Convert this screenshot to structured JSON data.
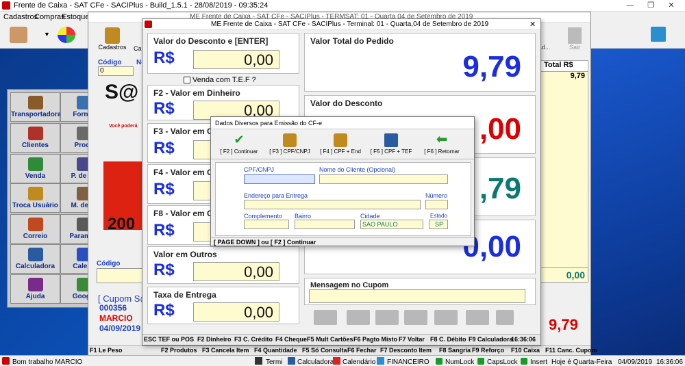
{
  "main_window": {
    "title": "Frente de Caixa - SAT CFe - SACIPlus - Build_1.5.1 - 28/08/2019 - 09:35:24",
    "menu": [
      "Cadastros",
      "Compras",
      "Estoque"
    ],
    "minimize": "—",
    "restore": "❐",
    "close": "✕"
  },
  "tiles": [
    {
      "label": "Transportadora",
      "color": "#8a5a2a"
    },
    {
      "label": "Fornec",
      "color": "#3a6fb0"
    },
    {
      "label": "Clientes",
      "color": "#b0302a"
    },
    {
      "label": "Produ",
      "color": "#6a6a6a"
    },
    {
      "label": "Venda",
      "color": "#2f8a3a"
    },
    {
      "label": "P. de Co",
      "color": "#4a4a8a"
    },
    {
      "label": "Troca Usuário",
      "color": "#c08a20"
    },
    {
      "label": "M. de Ar",
      "color": "#806040"
    },
    {
      "label": "Correio",
      "color": "#c04a20"
    },
    {
      "label": "Parametr",
      "color": "#5a5a5a"
    },
    {
      "label": "Calculadora",
      "color": "#2a5aa0"
    },
    {
      "label": "Calend",
      "color": "#2a4fc0"
    },
    {
      "label": "Ajuda",
      "color": "#7a2a8a"
    },
    {
      "label": "Google",
      "color": "#3a8a3a"
    }
  ],
  "pos_window": {
    "title": "ME Frente de Caixa - SAT CFe - SACIPlus - TERMSAT: 01 - Quarta 04 de Setembro de 2019",
    "codigo_label": "Código",
    "codigo_value": "0",
    "no_label": "No",
    "logo_text": "S@",
    "promo_text": "Você poderá",
    "year_text": "200",
    "codigo2_label": "Código",
    "cupom_label": "[ Cupom S@",
    "cupom_number": "000356",
    "operator": "MARCIO",
    "date": "04/09/2019",
    "total_header": "Total R$",
    "total_value": "9,79",
    "desconto_total": "0,00",
    "grand_total": "9,79",
    "toolbar_left_label": "Cadastros",
    "toolbar_left_label2": "Ca",
    "toolbar_right_label": "Ad...",
    "toolbar_sair": "Sair",
    "fkeys": [
      "F1 Le Peso",
      "F2 Produtos",
      "F3 Cancela Item",
      "F4 Quantidade",
      "F5 Só Consulta",
      "F6 Fechar",
      "F7 Desconto Item",
      "F8 Sangria",
      "F9 Reforço",
      "F10 Caixa",
      "F11 Canc. Cupom"
    ]
  },
  "payment_window": {
    "title": "ME Frente de Caixa - SAT CFe - SACIPlus - Terminal: 01 - Quarta,04 de Setembro de 2019",
    "desconto_label": "Valor do Desconto e [ENTER]",
    "desconto_value": "0,00",
    "tef_label": "Venda com T.E.F ?",
    "dinheiro_label": "F2 - Valor em Dinheiro",
    "dinheiro_value": "0,00",
    "f3_label": "F3 - Valor em C",
    "f4_label": "F4 - Valor em C",
    "f8_label": "F8 - Valor em C",
    "outros_label": "Valor em Outros",
    "outros_value": "0,00",
    "entrega_label": "Taxa de Entrega",
    "entrega_value": "0,00",
    "currency": "R$",
    "total_pedido_label": "Valor Total do Pedido",
    "total_pedido_value": "9,79",
    "valor_desconto_label": "Valor do Desconto",
    "valor_desconto_value": ",00",
    "mid_value": ",79",
    "low_value": "0,00",
    "mensagem_label": "Mensagem no Cupom",
    "fkeys": [
      "ESC TEF ou POS",
      "F2 Dinheiro",
      "F3 C. Crédito",
      "F4 Cheque",
      "F5 Mult Cartões",
      "F6 Pagto Misto",
      "F7 Voltar",
      "F8 C. Débito",
      "F9 Calculadora",
      "16:36:06"
    ],
    "close": "✕"
  },
  "dialog": {
    "title": "Dados Diversos para Emissão do CF-e",
    "buttons": [
      "[ F2 ] Continuar",
      "[ F3 ] CPF/CNPJ",
      "[ F4 ] CPF + End",
      "[ F5 ] CPF + TEF",
      "[ F6 ] Retornar"
    ],
    "cpf_label": "CPF/CNPJ",
    "nome_label": "Nome do Cliente (Opcional)",
    "endereco_label": "Endereço para Entrega",
    "numero_label": "Número",
    "complemento_label": "Complemento",
    "bairro_label": "Bairro",
    "cidade_label": "Cidade",
    "cidade_value": "SAO PAULO",
    "estado_label": "Estado",
    "estado_value": "SP",
    "footer": "[ PAGE DOWN ] ou [ F2 ] Continuar"
  },
  "taskbar": {
    "greeting": "Bom trabalho MARCIO",
    "termi": "Termi",
    "calculadora": "Calculadora",
    "calendario": "Calendário",
    "financeiro": "FINANCEIRO",
    "numlock": "NumLock",
    "capslock": "CapsLock",
    "insert": "Insert",
    "day_text": "Hoje é Quarta-Feira",
    "date": "04/09/2019",
    "time": "16:36:06"
  }
}
